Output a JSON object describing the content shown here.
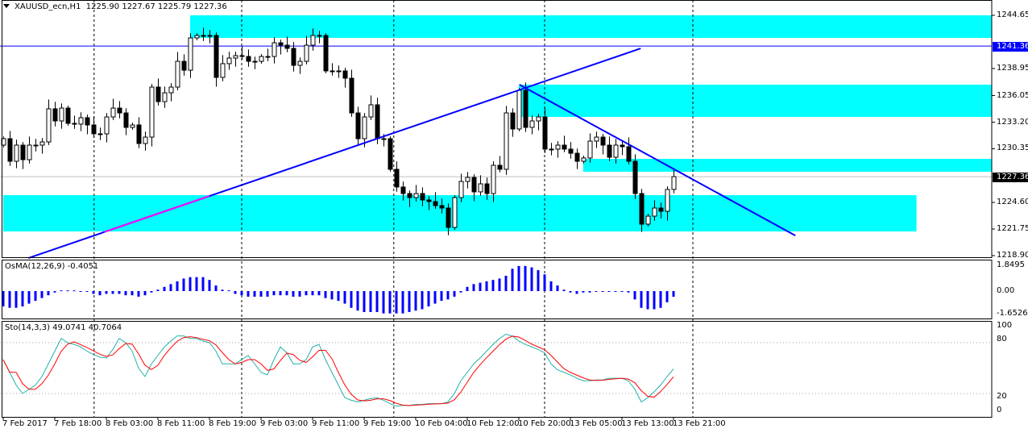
{
  "header": {
    "symbol_label": "XAUUSD_ecn,H1",
    "ohlc": "1225.90 1227.67 1225.79 1227.36"
  },
  "osma": {
    "label": "OsMA(12,26,9) -0.4051",
    "axis": [
      "1.8495",
      "0.00",
      "-1.6526"
    ]
  },
  "stoch": {
    "label": "Sto(14,3,3) 49.0741 40.7064",
    "axis": [
      "100",
      "80",
      "20",
      "0"
    ]
  },
  "price_axis": [
    "1244.65",
    "1238.95",
    "1236.05",
    "1233.20",
    "1230.35",
    "1224.60",
    "1221.75",
    "1218.90"
  ],
  "tags": {
    "hline": "1241.36",
    "bid": "1227.36"
  },
  "time_axis": [
    "7 Feb 2017",
    "7 Feb 18:00",
    "8 Feb 03:00",
    "8 Feb 11:00",
    "8 Feb 19:00",
    "9 Feb 03:00",
    "9 Feb 11:00",
    "9 Feb 19:00",
    "10 Feb 04:00",
    "10 Feb 12:00",
    "10 Feb 20:00",
    "13 Feb 05:00",
    "13 Feb 13:00",
    "13 Feb 21:00"
  ],
  "colors": {
    "bull": "#ffffff",
    "bear": "#000000",
    "zone": "#00ffff",
    "line": "#0000ff",
    "pink": "#ff00ff",
    "stoch_k": "#20b2aa",
    "stoch_d": "#ff0000",
    "osma": "#0000ff"
  },
  "chart_data": {
    "type": "candlestick",
    "title": "XAUUSD_ecn,H1",
    "ylim": [
      1218.9,
      1244.65
    ],
    "first_open": 1230.74,
    "closes": [
      1231.43,
      1229.01,
      1230.74,
      1229.18,
      1230.74,
      1230.74,
      1231.08,
      1234.63,
      1233.33,
      1234.71,
      1233.07,
      1232.99,
      1233.68,
      1232.9,
      1231.95,
      1231.95,
      1233.76,
      1234.71,
      1234.19,
      1232.64,
      1232.9,
      1230.91,
      1231.6,
      1236.96,
      1235.4,
      1236.35,
      1236.96,
      1239.72,
      1238.77,
      1242.23,
      1242.49,
      1242.4,
      1242.49,
      1238.0,
      1239.47,
      1240.07,
      1240.33,
      1240.24,
      1239.72,
      1239.72,
      1240.24,
      1240.24,
      1241.71,
      1241.45,
      1241.11,
      1239.29,
      1239.72,
      1241.45,
      1242.49,
      1242.49,
      1238.69,
      1238.69,
      1238.69,
      1237.91,
      1234.19,
      1231.43,
      1233.76,
      1235.06,
      1231.43,
      1231.43,
      1228.15,
      1226.25,
      1225.55,
      1225.12,
      1225.55,
      1224.86,
      1224.69,
      1224.26,
      1224.0,
      1221.92,
      1225.12,
      1226.85,
      1227.28,
      1225.73,
      1226.59,
      1225.55,
      1228.58,
      1228.15,
      1234.19,
      1232.47,
      1236.61,
      1232.64,
      1233.33,
      1233.76,
      1230.31,
      1230.31,
      1230.74,
      1230.31,
      1229.87,
      1229.01,
      1229.36,
      1231.17,
      1231.6,
      1230.74,
      1229.44,
      1230.74,
      1230.57,
      1229.01,
      1225.55,
      1222.27,
      1223.13,
      1224.0,
      1223.65,
      1225.99,
      1227.36
    ],
    "zones": [
      {
        "from_bar": 29,
        "top": 1244.65,
        "bottom": 1242.23
      },
      {
        "from_bar": 80,
        "top": 1237.22,
        "bottom": 1233.76
      },
      {
        "from_bar": 90,
        "top": 1229.27,
        "bottom": 1227.89
      },
      {
        "from_bar": 0,
        "to_bar": 141.7,
        "top": 1225.38,
        "bottom": 1221.49
      }
    ],
    "hline": 1241.36,
    "bid": 1227.36,
    "trendlines": [
      {
        "bar1": 3.9,
        "price1": 1218.64,
        "bar2": 98.9,
        "price2": 1241.1
      },
      {
        "bar1": 80.1,
        "price1": 1237.22,
        "bar2": 122.9,
        "price2": 1221.05
      }
    ],
    "highlight_segment": {
      "bar1": 15.7,
      "bar2": 32
    },
    "separators_bars": [
      14.1,
      37,
      60.6,
      84,
      107
    ],
    "time_label_every_bars": 8,
    "osma": {
      "ylim": [
        -1.6526,
        1.8495
      ],
      "values": [
        -1.1,
        -1.2,
        -1.2,
        -1.1,
        -0.9,
        -0.7,
        -0.5,
        -0.3,
        -0.1,
        0.05,
        0.05,
        0.05,
        0,
        0,
        -0.2,
        -0.3,
        -0.2,
        -0.2,
        -0.2,
        -0.3,
        -0.3,
        -0.4,
        -0.3,
        -0.1,
        0.1,
        0.3,
        0.5,
        0.7,
        0.9,
        1.0,
        1.0,
        1.0,
        0.8,
        0.4,
        0.1,
        0.05,
        -0.2,
        -0.3,
        -0.4,
        -0.4,
        -0.4,
        -0.4,
        -0.3,
        -0.3,
        -0.3,
        -0.4,
        -0.4,
        -0.3,
        -0.3,
        -0.3,
        -0.5,
        -0.6,
        -0.7,
        -0.9,
        -1.2,
        -1.4,
        -1.5,
        -1.5,
        -1.5,
        -1.6,
        -1.6,
        -1.6,
        -1.6,
        -1.5,
        -1.4,
        -1.3,
        -1.1,
        -0.9,
        -0.7,
        -0.6,
        -0.4,
        -0.1,
        0.3,
        0.5,
        0.6,
        0.7,
        0.8,
        0.9,
        1.1,
        1.6,
        1.8,
        1.8,
        1.7,
        1.5,
        1.2,
        0.7,
        0.4,
        0.1,
        -0.1,
        -0.2,
        -0.1,
        -0.1,
        0,
        0,
        0,
        0,
        0,
        -0.1,
        -0.6,
        -1.2,
        -1.3,
        -1.3,
        -1.2,
        -0.8,
        -0.4051
      ]
    },
    "stochastic": {
      "ylim": [
        0,
        100
      ],
      "levels": [
        20,
        80
      ],
      "k": [
        60,
        45,
        30,
        20,
        25,
        30,
        40,
        55,
        70,
        85,
        80,
        78,
        75,
        70,
        66,
        63,
        62,
        72,
        85,
        80,
        70,
        50,
        40,
        55,
        65,
        75,
        82,
        88,
        88,
        85,
        85,
        82,
        80,
        70,
        55,
        55,
        55,
        60,
        65,
        55,
        45,
        42,
        60,
        75,
        68,
        55,
        55,
        60,
        75,
        78,
        60,
        45,
        30,
        15,
        12,
        10,
        12,
        14,
        15,
        12,
        8,
        5,
        6,
        6,
        7,
        7,
        8,
        8,
        8,
        10,
        20,
        35,
        45,
        55,
        62,
        70,
        78,
        85,
        90,
        88,
        82,
        78,
        75,
        72,
        68,
        55,
        48,
        45,
        42,
        38,
        35,
        35,
        36,
        36,
        38,
        38,
        38,
        35,
        25,
        10,
        15,
        22,
        30,
        40,
        49.07
      ]
    }
  }
}
